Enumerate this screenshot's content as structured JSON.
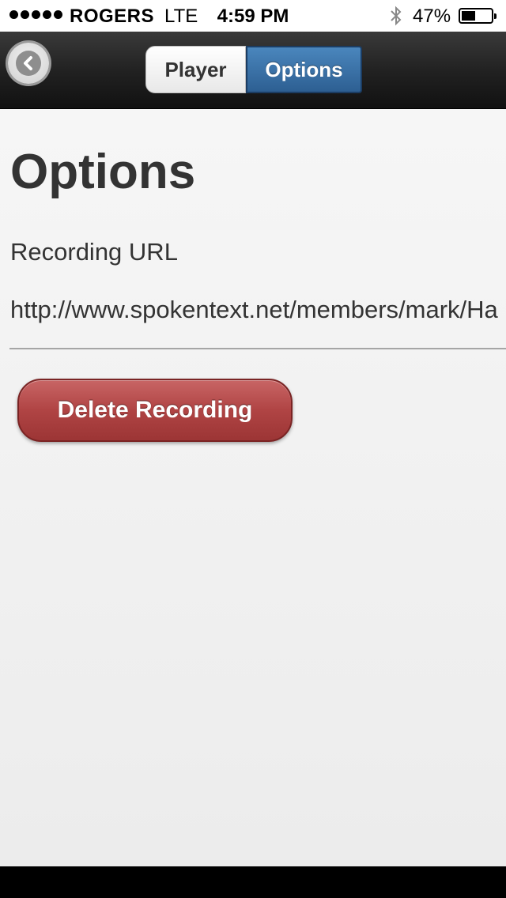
{
  "status_bar": {
    "carrier": "ROGERS",
    "network": "LTE",
    "time": "4:59 PM",
    "battery_percent": "47%",
    "battery_level": 0.47,
    "signal_dots": 5
  },
  "nav": {
    "back_icon": "chevron-left-icon",
    "segments": [
      {
        "label": "Player",
        "selected": false
      },
      {
        "label": "Options",
        "selected": true
      }
    ],
    "selected_color": "#3a74aa"
  },
  "content": {
    "title": "Options",
    "recording_url_label": "Recording URL",
    "recording_url_value": "http://www.spokentext.net/members/mark/Ha",
    "delete_button_label": "Delete Recording",
    "delete_button_color": "#b04444"
  }
}
